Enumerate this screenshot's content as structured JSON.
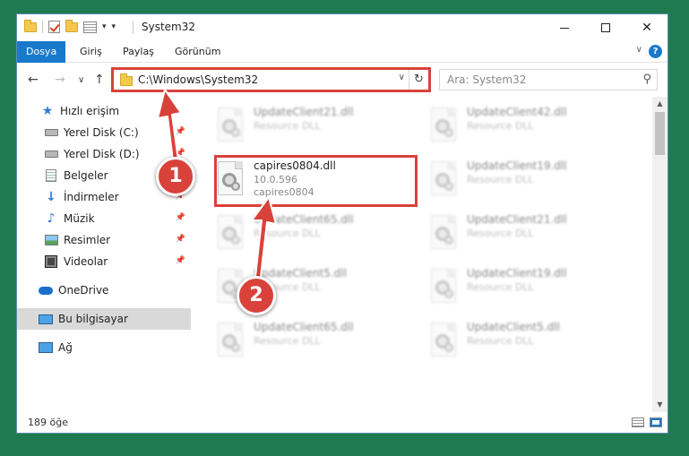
{
  "window": {
    "title": "System32"
  },
  "ribbon": {
    "tabs": [
      {
        "label": "Dosya",
        "active": true
      },
      {
        "label": "Giriş",
        "active": false
      },
      {
        "label": "Paylaş",
        "active": false
      },
      {
        "label": "Görünüm",
        "active": false
      }
    ],
    "help_label": "?"
  },
  "address": {
    "path": "C:\\Windows\\System32",
    "search_placeholder": "Ara: System32"
  },
  "navpane": {
    "items": [
      {
        "label": "Hızlı erişim",
        "icon": "star-icon",
        "pinned": false,
        "selected": false
      },
      {
        "label": "Yerel Disk (C:)",
        "icon": "disk-icon",
        "pinned": true,
        "selected": false
      },
      {
        "label": "Yerel Disk (D:)",
        "icon": "disk-icon",
        "pinned": true,
        "selected": false
      },
      {
        "label": "Belgeler",
        "icon": "documents-icon",
        "pinned": true,
        "selected": false
      },
      {
        "label": "İndirmeler",
        "icon": "download-icon",
        "pinned": true,
        "selected": false
      },
      {
        "label": "Müzik",
        "icon": "music-icon",
        "pinned": true,
        "selected": false
      },
      {
        "label": "Resimler",
        "icon": "pictures-icon",
        "pinned": true,
        "selected": false
      },
      {
        "label": "Videolar",
        "icon": "videos-icon",
        "pinned": true,
        "selected": false
      },
      {
        "label": "OneDrive",
        "icon": "onedrive-icon",
        "pinned": false,
        "selected": false
      },
      {
        "label": "Bu bilgisayar",
        "icon": "this-pc-icon",
        "pinned": false,
        "selected": true
      },
      {
        "label": "Ağ",
        "icon": "network-icon",
        "pinned": false,
        "selected": false
      }
    ]
  },
  "files": {
    "highlighted": {
      "name": "capires0804.dll",
      "version": "10.0.596",
      "description": "capires0804"
    },
    "blurred": [
      {
        "name": "UpdateClient21.dll",
        "type": "Resource DLL"
      },
      {
        "name": "UpdateClient42.dll",
        "type": "Resource DLL"
      },
      {
        "name": "UpdateClient19.dll",
        "type": "Resource DLL"
      },
      {
        "name": "UpdateClient65.dll",
        "type": "Resource DLL"
      },
      {
        "name": "UpdateClient21.dll",
        "type": "Resource DLL"
      },
      {
        "name": "UpdateClient5.dll",
        "type": "Resource DLL"
      },
      {
        "name": "UpdateClient19.dll",
        "type": "Resource DLL"
      },
      {
        "name": "UpdateClient65.dll",
        "type": "Resource DLL"
      },
      {
        "name": "UpdateClient5.dll",
        "type": "Resource DLL"
      }
    ]
  },
  "status": {
    "item_count": "189 öğe"
  },
  "annotations": {
    "badge1": "1",
    "badge2": "2",
    "color": "#d9423a"
  }
}
